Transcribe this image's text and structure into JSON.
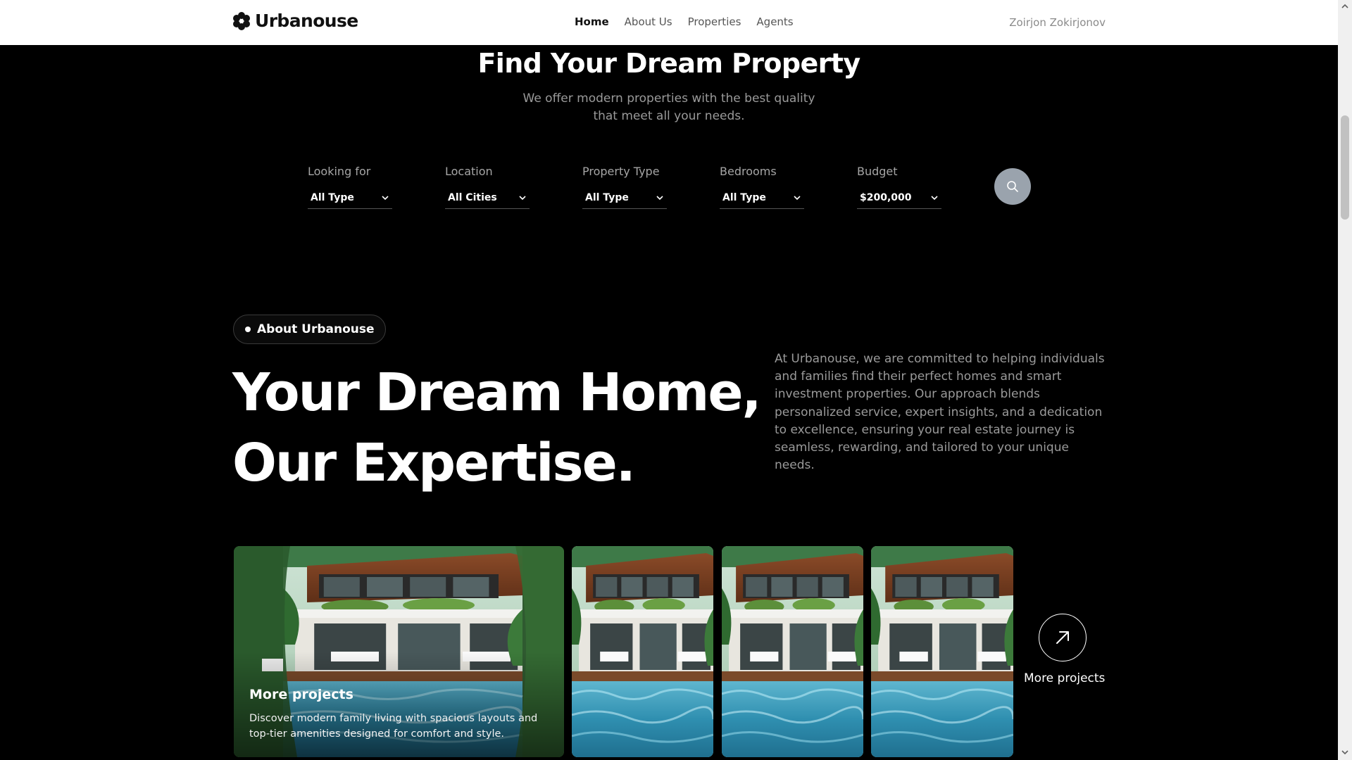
{
  "header": {
    "brand": "Urbanouse",
    "nav": [
      {
        "label": "Home",
        "active": true
      },
      {
        "label": "About Us",
        "active": false
      },
      {
        "label": "Properties",
        "active": false
      },
      {
        "label": "Agents",
        "active": false
      }
    ],
    "user_name": "Zoirjon Zokirjonov"
  },
  "hero": {
    "title": "Find Your Dream Property",
    "subtitle": "We offer modern properties with the best quality that meet all your needs."
  },
  "filters": [
    {
      "label": "Looking for",
      "value": "All Type"
    },
    {
      "label": "Location",
      "value": "All Cities"
    },
    {
      "label": "Property Type",
      "value": "All Type"
    },
    {
      "label": "Bedrooms",
      "value": "All Type"
    },
    {
      "label": "Budget",
      "value": "$200,000"
    }
  ],
  "search_icon": "search-icon",
  "about": {
    "badge": "About Urbanouse",
    "heading_line1": "Your Dream Home,",
    "heading_line2": "Our Expertise.",
    "text": "At Urbanouse, we are committed to helping individuals and families find their perfect homes and smart investment properties. Our approach blends personalized service, expert insights, and a dedication to excellence, ensuring your real estate journey is seamless, rewarding, and tailored to your unique needs."
  },
  "gallery": {
    "featured_title": "More projects",
    "featured_desc": "Discover modern family living with spacious layouts and top-tier amenities designed for comfort and style.",
    "more_label": "More projects",
    "more_icon": "arrow-up-right-icon"
  },
  "colors": {
    "background": "#000000",
    "header_bg": "#ffffff",
    "muted_text": "#9a9a9a",
    "search_button": "#9aa3ad"
  }
}
